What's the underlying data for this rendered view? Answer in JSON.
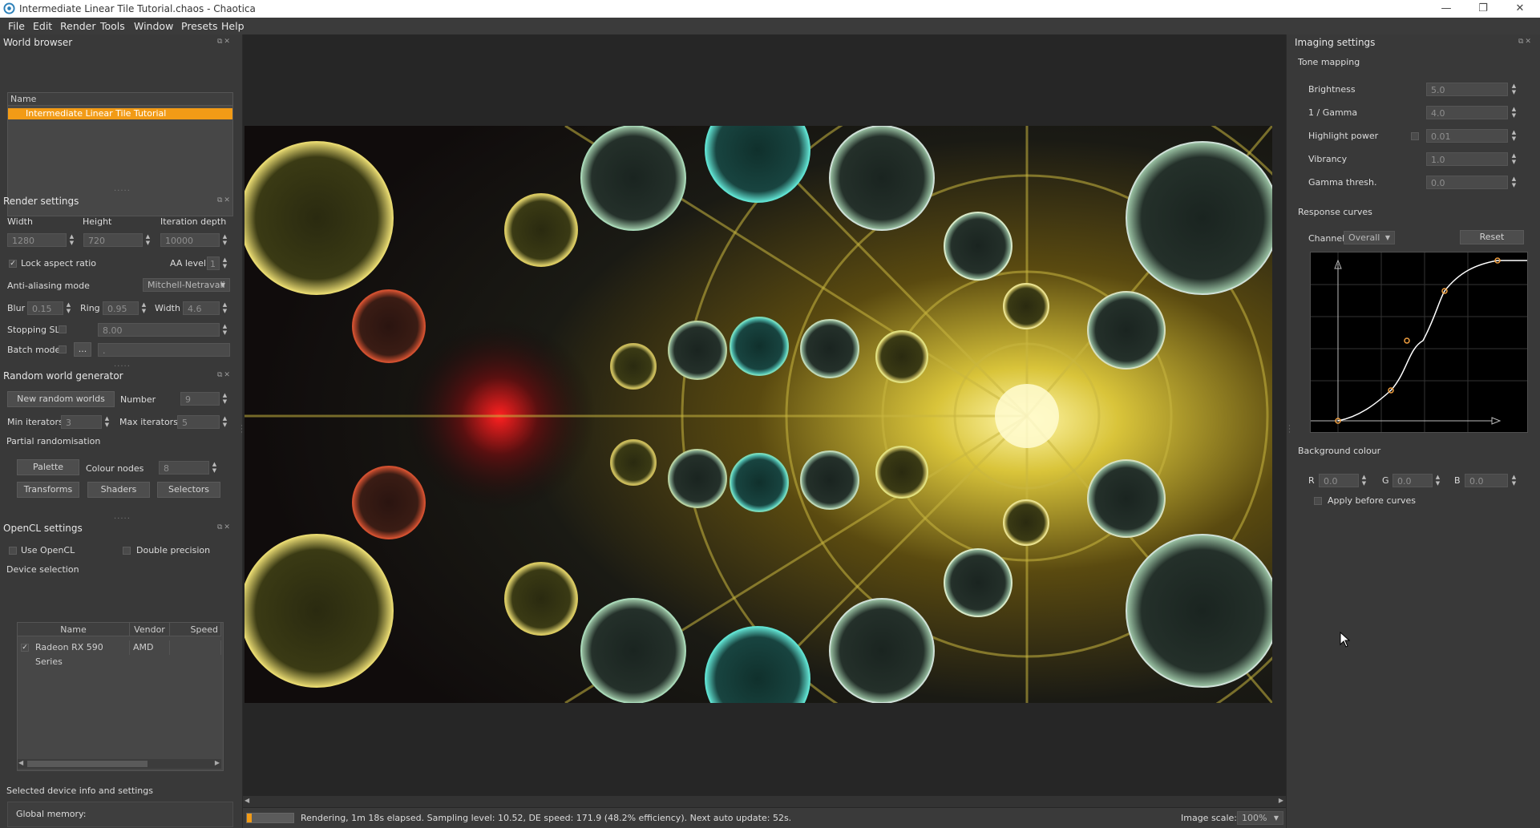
{
  "window": {
    "title": "Intermediate Linear Tile Tutorial.chaos - Chaotica",
    "minimize": "—",
    "restore": "❐",
    "close": "✕"
  },
  "menu": [
    "File",
    "Edit",
    "Render",
    "Tools",
    "Window",
    "Presets",
    "Help"
  ],
  "world_browser": {
    "title": "World browser",
    "column": "Name",
    "items": [
      "Intermediate Linear Tile Tutorial"
    ]
  },
  "render_settings": {
    "title": "Render settings",
    "width_label": "Width",
    "height_label": "Height",
    "depth_label": "Iteration depth",
    "width": "1280",
    "height": "720",
    "depth": "10000",
    "lock_aspect": "Lock aspect ratio",
    "aa_level_label": "AA level",
    "aa_level": "1",
    "aa_mode_label": "Anti-aliasing mode",
    "aa_mode": "Mitchell-Netravali",
    "blur_label": "Blur",
    "blur": "0.15",
    "ring_label": "Ring",
    "ring": "0.95",
    "filter_width_label": "Width",
    "filter_width": "4.6",
    "stopping_label": "Stopping SL",
    "stopping": "8.00",
    "batch_label": "Batch mode",
    "batch_btn": "...",
    "batch_path": "."
  },
  "random_world": {
    "title": "Random world generator",
    "new_btn": "New random worlds",
    "number_label": "Number",
    "number": "9",
    "min_label": "Min iterators",
    "min": "3",
    "max_label": "Max iterators",
    "max": "5",
    "partial_label": "Partial randomisation",
    "palette_btn": "Palette",
    "colour_nodes_label": "Colour nodes",
    "colour_nodes": "8",
    "transforms_btn": "Transforms",
    "shaders_btn": "Shaders",
    "selectors_btn": "Selectors"
  },
  "opencl": {
    "title": "OpenCL settings",
    "use": "Use OpenCL",
    "double": "Double precision",
    "device_selection": "Device selection",
    "columns": [
      "Name",
      "Vendor",
      "Speed"
    ],
    "device_name": "Radeon RX 590 Series",
    "device_vendor": "AMD",
    "device_info": "Selected device info and settings",
    "global_memory": "Global memory:"
  },
  "status": {
    "text": "Rendering, 1m 18s elapsed. Sampling level: 10.52, DE speed: 171.9 (48.2% efficiency). Next auto update: 52s.",
    "progress": 0.11,
    "scale_label": "Image scale:",
    "scale": "100%"
  },
  "imaging": {
    "title": "Imaging settings",
    "tone_mapping": "Tone mapping",
    "brightness_label": "Brightness",
    "brightness": "5.0",
    "gamma_label": "1 / Gamma",
    "gamma": "4.0",
    "highlight_label": "Highlight power",
    "highlight": "0.01",
    "vibrancy_label": "Vibrancy",
    "vibrancy": "1.0",
    "gamma_thresh_label": "Gamma thresh.",
    "gamma_thresh": "0.0",
    "response_curves": "Response curves",
    "channel_label": "Channel:",
    "channel": "Overall",
    "reset_btn": "Reset",
    "background_colour": "Background colour",
    "r_label": "R",
    "r": "0.0",
    "g_label": "G",
    "g": "0.0",
    "b_label": "B",
    "b": "0.0",
    "apply_before": "Apply before curves"
  },
  "colors": {
    "accent": "#f29b16",
    "panel": "#393939",
    "viewport": "#262626"
  }
}
